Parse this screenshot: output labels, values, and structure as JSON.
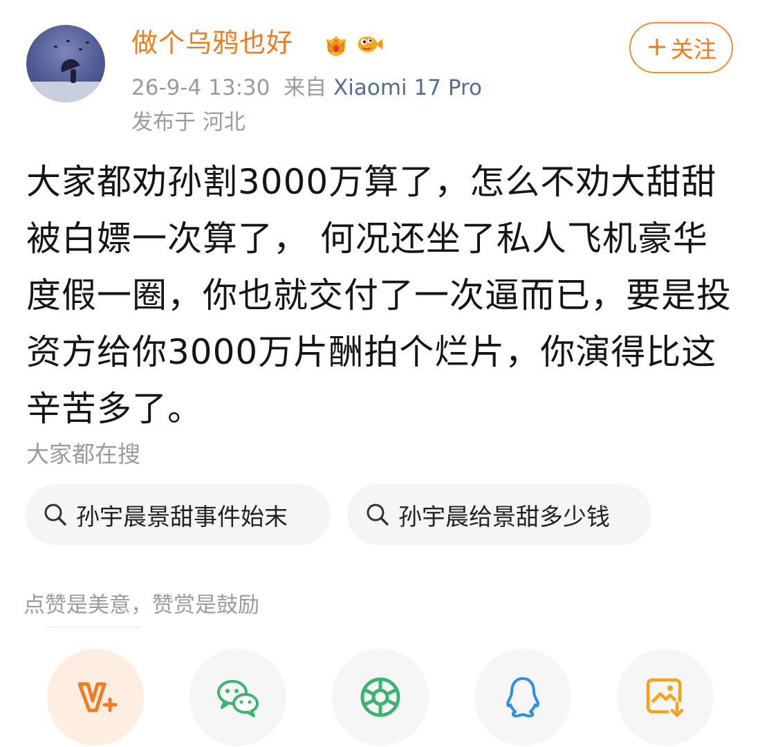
{
  "post": {
    "username": "做个乌鸦也好",
    "badges": [
      "crown-badge-icon",
      "fish-badge-icon"
    ],
    "timestamp": "26-9-4 13:30",
    "source_prefix": "来自",
    "device": "Xiaomi 17 Pro",
    "location_prefix": "发布于",
    "location": "河北",
    "follow_label": "关注",
    "text": "大家都劝孙割3000万算了，怎么不劝大甜甜被白嫖一次算了， 何况还坐了私人飞机豪华度假一圈，你也就交付了一次逼而已，要是投资方给你3000万片酬拍个烂片，你演得比这辛苦多了。"
  },
  "search": {
    "title": "大家都在搜",
    "chips": [
      {
        "label": "孙宇晨景甜事件始末"
      },
      {
        "label": "孙宇晨给景甜多少钱"
      }
    ]
  },
  "reward": {
    "hint": "点赞是美意，赞赏是鼓励"
  },
  "share": {
    "items": [
      "vplus-icon",
      "wechat-icon",
      "moments-icon",
      "qq-icon",
      "save-image-icon"
    ]
  },
  "colors": {
    "accent": "#ee7d21",
    "device_link": "#526d93",
    "muted": "#9b9b9b"
  }
}
